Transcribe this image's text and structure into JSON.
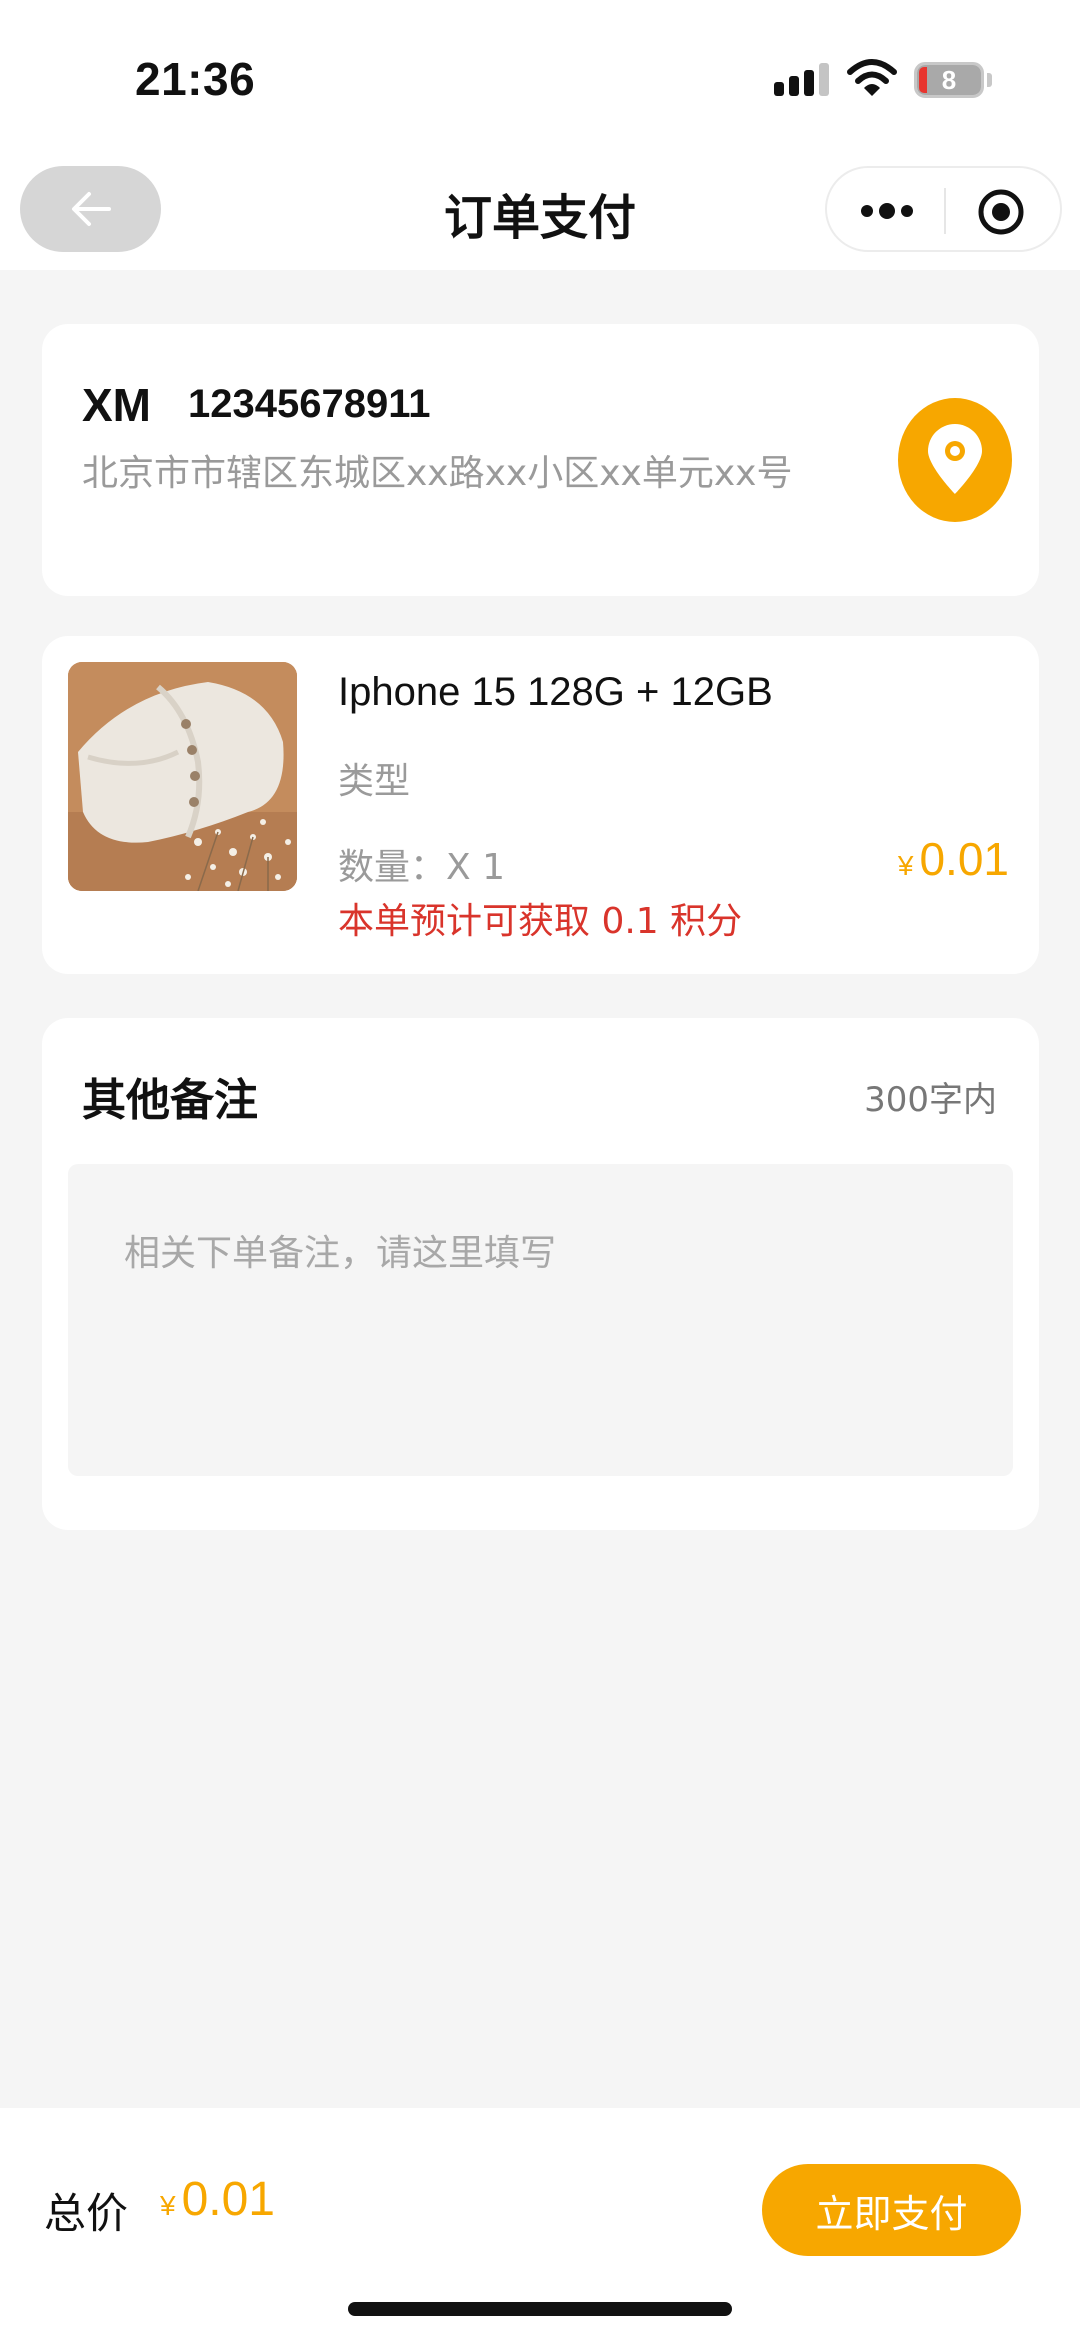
{
  "status_bar": {
    "time": "21:36",
    "battery_level": "8",
    "icons": [
      "cellular-signal-icon",
      "wifi-icon",
      "battery-icon"
    ]
  },
  "nav": {
    "title": "订单支付",
    "back_icon": "arrow-left-icon",
    "more_icon": "more-dots-icon",
    "close_icon": "target-circle-icon"
  },
  "address": {
    "name": "XM",
    "phone": "12345678911",
    "detail": "北京市市辖区东城区xx路xx小区xx单元xx号",
    "icon": "location-pin-icon"
  },
  "goods": {
    "name": "Iphone 15 128G + 12GB",
    "type_label": "类型",
    "quantity": "数量：X 1",
    "price_symbol": "¥",
    "price": "0.01",
    "points_note": "本单预计可获取 0.1 积分"
  },
  "note": {
    "title": "其他备注",
    "limit": "300字内",
    "placeholder": "相关下单备注，请这里填写",
    "value": ""
  },
  "footer": {
    "total_label": "总价",
    "price_symbol": "¥",
    "total": "0.01",
    "pay_label": "立即支付"
  },
  "colors": {
    "accent": "#f7a700",
    "points_red": "#d9342b",
    "muted": "#9a9a9a",
    "background": "#f5f5f5"
  }
}
